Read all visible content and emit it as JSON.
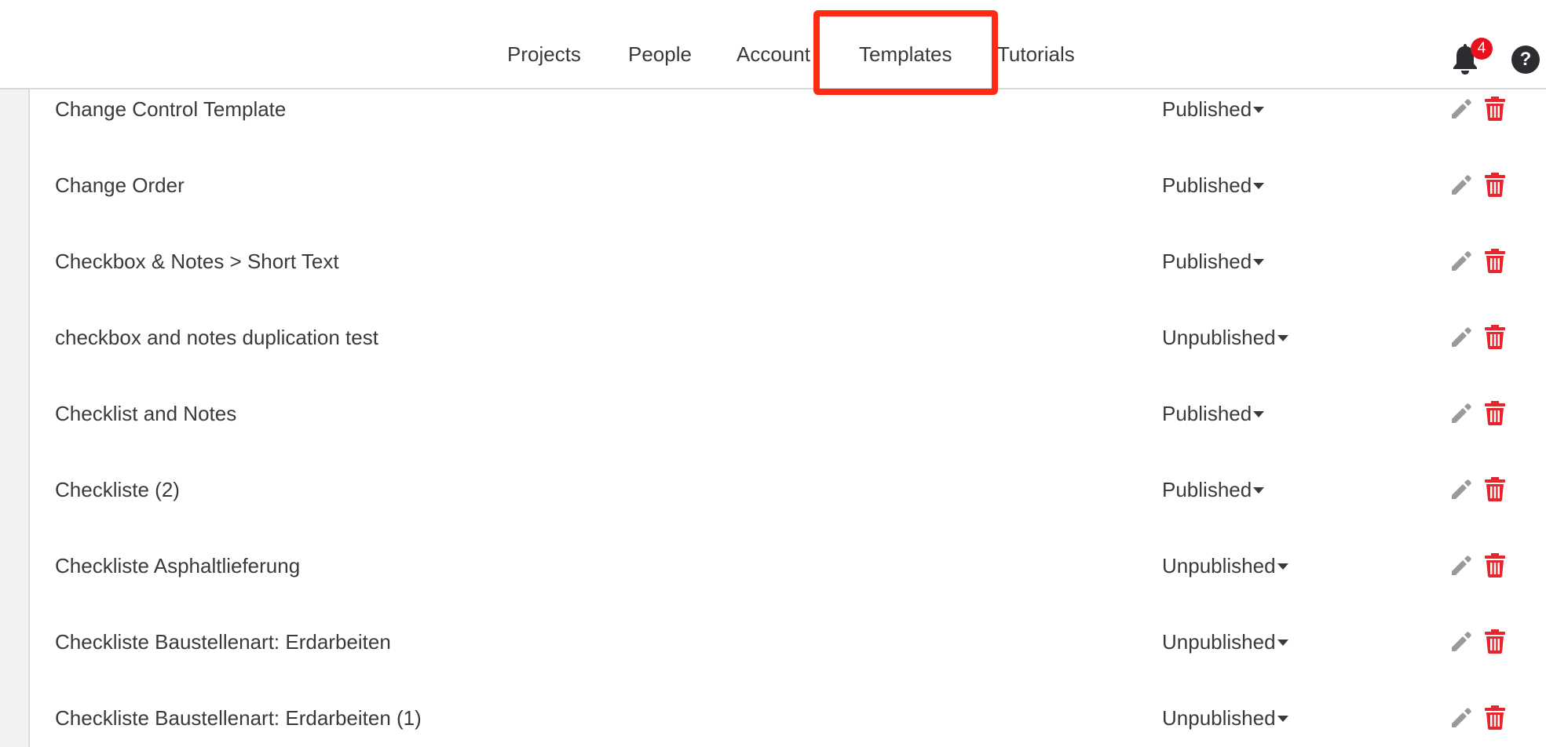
{
  "nav": {
    "items": [
      {
        "label": "Projects"
      },
      {
        "label": "People"
      },
      {
        "label": "Account"
      },
      {
        "label": "Templates"
      },
      {
        "label": "Tutorials"
      }
    ],
    "notifications_count": "4",
    "help_label": "?"
  },
  "templates": [
    {
      "name": "Change Control Template",
      "status": "Published"
    },
    {
      "name": "Change Order",
      "status": "Published"
    },
    {
      "name": "Checkbox & Notes > Short Text",
      "status": "Published"
    },
    {
      "name": "checkbox and notes duplication test",
      "status": "Unpublished"
    },
    {
      "name": "Checklist and Notes",
      "status": "Published"
    },
    {
      "name": "Checkliste (2)",
      "status": "Published"
    },
    {
      "name": "Checkliste Asphaltlieferung",
      "status": "Unpublished"
    },
    {
      "name": "Checkliste Baustellenart: Erdarbeiten",
      "status": "Unpublished"
    },
    {
      "name": "Checkliste Baustellenart: Erdarbeiten (1)",
      "status": "Unpublished"
    }
  ],
  "colors": {
    "highlight": "#ff2a14",
    "badge": "#e8121f",
    "delete": "#e8242d",
    "edit": "#9a9a9a",
    "text": "#3a3a3a"
  },
  "icons": {
    "notifications": "bell-icon",
    "help": "help-icon",
    "edit": "pencil-icon",
    "delete": "trash-icon",
    "status_menu": "caret-down-icon"
  }
}
